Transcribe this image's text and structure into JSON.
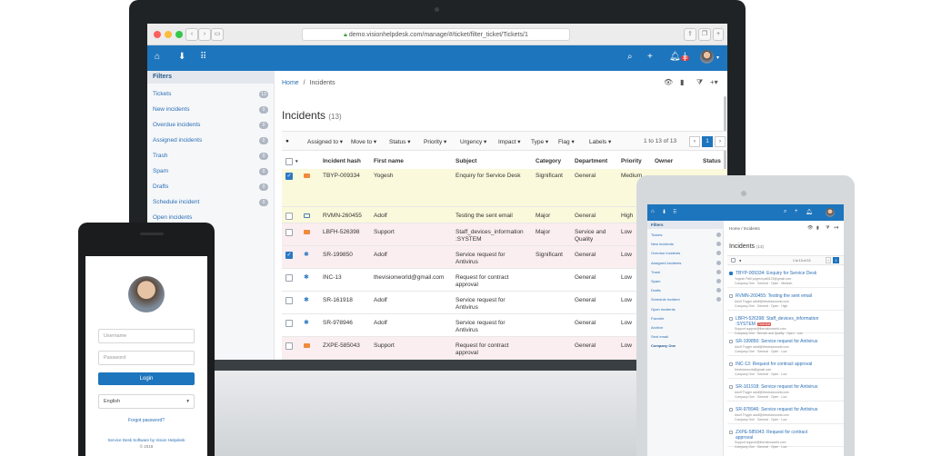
{
  "browser": {
    "url": "demo.visionhelpdesk.com/manage/#/ticket/filter_ticket/Tickets/1"
  },
  "header": {
    "notification_count": "30"
  },
  "sidebar": {
    "title": "Filters",
    "items": [
      {
        "label": "Tickets",
        "count": "13"
      },
      {
        "label": "New incidents",
        "count": "0"
      },
      {
        "label": "Overdue incidents",
        "count": "0"
      },
      {
        "label": "Assigned incidents",
        "count": "0"
      },
      {
        "label": "Trash",
        "count": "0"
      },
      {
        "label": "Spam",
        "count": "0"
      },
      {
        "label": "Drafts",
        "count": "0"
      },
      {
        "label": "Schedule incident",
        "count": "0"
      },
      {
        "label": "Open incidents",
        "count": ""
      }
    ]
  },
  "main": {
    "breadcrumb_home": "Home",
    "breadcrumb_sep": "/",
    "breadcrumb_current": "Incidents",
    "title": "Incidents",
    "count": "(13)",
    "toolbar": [
      "Assigned to ▾",
      "Move to ▾",
      "Status ▾",
      "Priority ▾",
      "Urgency ▾",
      "Impact ▾",
      "Type ▾",
      "Flag ▾",
      "Labels ▾"
    ],
    "pager_text": "1 to 13 of 13",
    "pager_page": "1",
    "columns": [
      "Incident hash",
      "First name",
      "Subject",
      "Category",
      "Department",
      "Priority",
      "Owner",
      "Status"
    ],
    "rows": [
      {
        "hash": "TBYP-009334",
        "name": "Yogesh",
        "subject": "Enquiry for Service Desk",
        "subject2": "",
        "category": "Significant",
        "department": "General",
        "department2": "",
        "priority": "Medium",
        "checked": true,
        "icon": "envelope",
        "hl": "#fbf9dc"
      },
      {
        "hash": "RVMN-260455",
        "name": "Adolf",
        "subject": "Testing the sent email",
        "subject2": "",
        "category": "Major",
        "department": "General",
        "department2": "",
        "priority": "High",
        "checked": false,
        "icon": "monitor",
        "hl": "#fbf9dc"
      },
      {
        "hash": "LBFH-526398",
        "name": "Support",
        "subject": "Staff_devices_information",
        "subject2": ":SYSTEM",
        "category": "Major",
        "department": "Service and",
        "department2": "Quality",
        "priority": "Low",
        "checked": false,
        "icon": "envelope",
        "hl": "#fbeef0"
      },
      {
        "hash": "SR-199850",
        "name": "Adolf",
        "subject": "Service request for",
        "subject2": "Antivirus",
        "category": "Significant",
        "department": "General",
        "department2": "",
        "priority": "Low",
        "checked": true,
        "icon": "pin",
        "hl": "#fbeef0"
      },
      {
        "hash": "INC-13",
        "name": "thevisionworld@gmail.com",
        "subject": "Request for contract",
        "subject2": "approval",
        "category": "",
        "department": "General",
        "department2": "",
        "priority": "Low",
        "checked": false,
        "icon": "pin",
        "hl": "#ffffff"
      },
      {
        "hash": "SR-161918",
        "name": "Adolf",
        "subject": "Service request for",
        "subject2": "Antivirus",
        "category": "",
        "department": "General",
        "department2": "",
        "priority": "Low",
        "checked": false,
        "icon": "pin",
        "hl": "#ffffff"
      },
      {
        "hash": "SR-978946",
        "name": "Adolf",
        "subject": "Service request for",
        "subject2": "Antivirus",
        "category": "",
        "department": "General",
        "department2": "",
        "priority": "Low",
        "checked": false,
        "icon": "pin",
        "hl": "#ffffff"
      },
      {
        "hash": "ZXPE-585043",
        "name": "Support",
        "subject": "Request for contract",
        "subject2": "approval",
        "category": "",
        "department": "General",
        "department2": "",
        "priority": "Low",
        "checked": false,
        "icon": "envelope",
        "hl": "#fbeef0"
      }
    ]
  },
  "phone": {
    "username_placeholder": "Username",
    "password_placeholder": "Password",
    "login_label": "Login",
    "language": "English",
    "forgot": "Forgot password?",
    "footer": "Service Desk Software by Vision Helpdesk",
    "copyright": "© 2018"
  },
  "tablet": {
    "sidebar_title": "Filters",
    "sidebar_items": [
      "Tickets",
      "New incidents",
      "Overdue incidents",
      "Assigned incidents",
      "Trash",
      "Spam",
      "Drafts",
      "Schedule incident",
      "Open incidents",
      "Favorite",
      "Archive",
      "Sent email",
      "Company One"
    ],
    "breadcrumb": "Home / Incidents",
    "title": "Incidents",
    "count": "(13)",
    "pager": "1 to 13 of 13",
    "page": "1",
    "items": [
      {
        "subject": "TBYP-009334: Enquiry for Service Desk",
        "tag": "",
        "meta1": "Yogesh Patil  yogesh.patil123@gmail.com",
        "meta2": "Company One · General · Open · Medium"
      },
      {
        "subject": "RVMN-260455: Testing the sent email",
        "tag": "",
        "meta1": "Adolf Thyger  adolf@thevisionworld.com",
        "meta2": "Company One · General · Open · High"
      },
      {
        "subject": "LBFH-526398: Staff_devices_information",
        "subject2": ":SYSTEM",
        "tag": "Overdue",
        "meta1": "Support  support@thevisionworld.com",
        "meta2": "Company One · Service and Quality · Open · Low"
      },
      {
        "subject": "SR-199850: Service request for Antivirus",
        "tag": "",
        "meta1": "Adolf Thyger  adolf@thevisionworld.com",
        "meta2": "Company One · General · Open · Low"
      },
      {
        "subject": "INC-13: Request for contract approval",
        "tag": "",
        "meta1": "thevisionworld@gmail.com",
        "meta2": "Company One · General · Open · Low"
      },
      {
        "subject": "SR-161918: Service request for Antivirus",
        "tag": "",
        "meta1": "Adolf Thyger  adolf@thevisionworld.com",
        "meta2": "Company One · General · Open · Low"
      },
      {
        "subject": "SR-978946: Service request for Antivirus",
        "tag": "",
        "meta1": "Adolf Thyger  adolf@thevisionworld.com",
        "meta2": "Company One · General · Open · Low"
      },
      {
        "subject": "ZXPE-585043: Request for contract",
        "subject2": "approval",
        "tag": "",
        "meta1": "Support  support@thevisionworld.com",
        "meta2": "Company One · General · Open · Low"
      }
    ]
  },
  "colors": {
    "brand": "#1d75bd",
    "envelope": "#f08a3c",
    "check": "#2c79c4"
  }
}
